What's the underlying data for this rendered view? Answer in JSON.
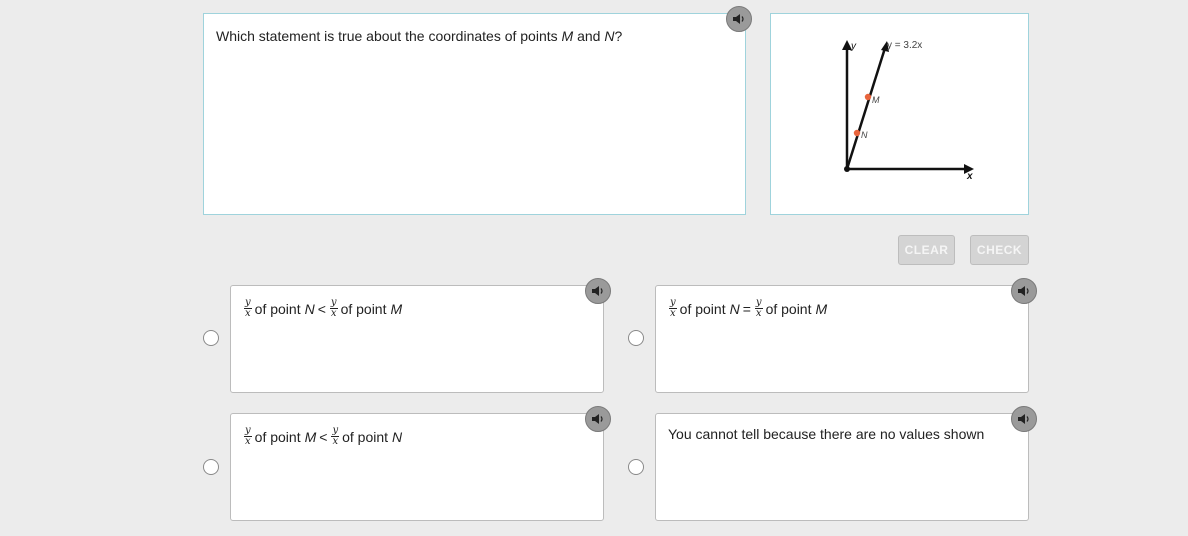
{
  "question": {
    "prefix": "Which statement is true about the coordinates of points",
    "point_a": "M",
    "conj": "and",
    "point_b": "N",
    "suffix": "?"
  },
  "figure": {
    "line_label": "y = 3.2x",
    "x_label": "x",
    "y_label": "y",
    "point_m_label": "M",
    "point_n_label": "N",
    "point_color": "#e8643c"
  },
  "buttons": {
    "clear_label": "CLEAR",
    "check_label": "CHECK"
  },
  "fraction": {
    "num": "y",
    "den": "x"
  },
  "options": [
    {
      "left_point": "N",
      "op": "<",
      "right_point": "M",
      "of_point": "of point"
    },
    {
      "left_point": "N",
      "op": "=",
      "right_point": "M",
      "of_point": "of point"
    },
    {
      "left_point": "M",
      "op": "<",
      "right_point": "N",
      "of_point": "of point"
    },
    {
      "text": "You cannot tell because there are no values shown"
    }
  ]
}
